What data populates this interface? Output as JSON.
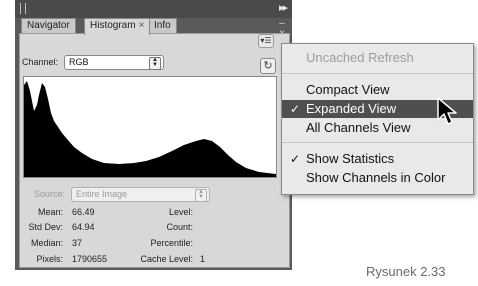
{
  "panel": {
    "tabs": [
      {
        "label": "Navigator",
        "active": false
      },
      {
        "label": "Histogram",
        "active": true,
        "close": "×"
      },
      {
        "label": "Info",
        "active": false
      }
    ],
    "channel_label": "Channel:",
    "channel_value": "RGB",
    "source_label": "Source:",
    "source_value": "Entire Image",
    "stats": {
      "mean_label": "Mean:",
      "mean_value": "66.49",
      "stddev_label": "Std Dev:",
      "stddev_value": "64.94",
      "median_label": "Median:",
      "median_value": "37",
      "pixels_label": "Pixels:",
      "pixels_value": "1790655",
      "level_label": "Level:",
      "count_label": "Count:",
      "percentile_label": "Percentile:",
      "cache_label": "Cache Level:",
      "cache_value": "1"
    },
    "icons": {
      "grip": "grip-icon",
      "collapse": "double-arrow-icon",
      "close": "close-icon",
      "flyout": "panel-menu-icon",
      "refresh": "refresh-icon"
    }
  },
  "menu": {
    "items": [
      {
        "label": "Uncached Refresh",
        "disabled": true,
        "checked": false
      },
      {
        "label": "Compact View",
        "disabled": false,
        "checked": false
      },
      {
        "label": "Expanded View",
        "disabled": false,
        "checked": true,
        "highlighted": true
      },
      {
        "label": "All Channels View",
        "disabled": false,
        "checked": false
      },
      {
        "label": "Show Statistics",
        "disabled": false,
        "checked": true
      },
      {
        "label": "Show Channels in Color",
        "disabled": false,
        "checked": false
      }
    ],
    "check_glyph": "✓"
  },
  "caption": "Rysunek 2.33",
  "colors": {
    "panel_bg": "#5a5a5a",
    "menu_highlight": "#4f4f4f",
    "histogram_fill": "#000000"
  }
}
